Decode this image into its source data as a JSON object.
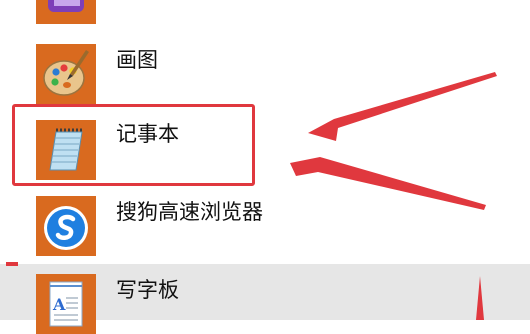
{
  "apps": [
    {
      "label": "",
      "icon": "onenote-icon"
    },
    {
      "label": "画图",
      "icon": "paint-palette-icon"
    },
    {
      "label": "记事本",
      "icon": "notepad-icon"
    },
    {
      "label": "搜狗高速浏览器",
      "icon": "sogou-browser-icon"
    },
    {
      "label": "写字板",
      "icon": "wordpad-icon"
    }
  ],
  "colors": {
    "tile": "#d96a1f",
    "highlight": "#e0383e",
    "selected_row": "#e6e6e6"
  }
}
